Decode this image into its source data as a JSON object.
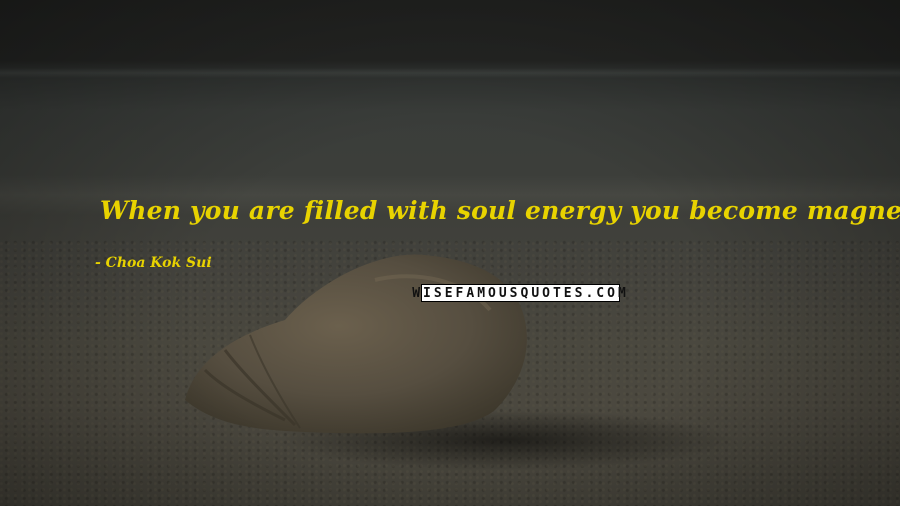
{
  "quote": {
    "text": "When you are filled with soul energy you become magnetic.",
    "author": "- Choa Kok Sui"
  },
  "watermark": {
    "text": "WISEFAMOUSQUOTES.COM"
  },
  "scene": {
    "subject": "seashell-on-beach",
    "text_color": "#e8d300",
    "background_tone": "#3e3f3a"
  }
}
